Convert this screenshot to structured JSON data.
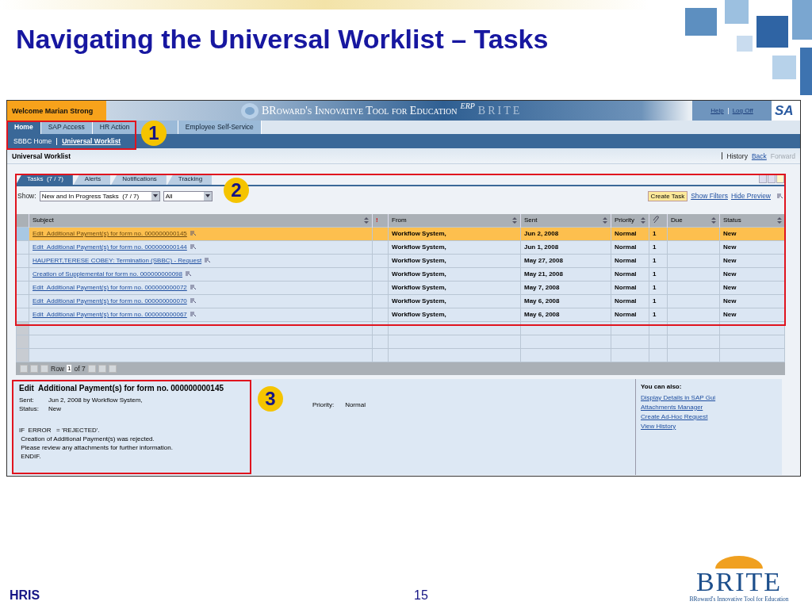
{
  "slide_title": "Navigating the Universal Worklist – Tasks",
  "screen": {
    "welcome": "Welcome Marian Strong",
    "banner": {
      "title": "BRoward's Innovative Tool for Education",
      "erp": "ERP",
      "brite": "BRITE"
    },
    "header_links": [
      "Help",
      "Log Off"
    ],
    "logo": "SA",
    "nav_tabs": [
      {
        "label": "Home",
        "selected": true
      },
      {
        "label": "SAP Access",
        "selected": false
      },
      {
        "label": "HR Action",
        "selected": false
      },
      {
        "label": "Employee Self-Service",
        "selected": false
      }
    ],
    "subnav": [
      {
        "label": "SBBC Home",
        "selected": false
      },
      {
        "label": "Universal Worklist",
        "selected": true
      }
    ],
    "page_title": "Universal Worklist",
    "history": {
      "history": "History",
      "back": "Back",
      "forward": "Forward",
      "forward_disabled": true
    },
    "worklist_tabs": [
      {
        "label": "Tasks  (7 / 7)",
        "selected": true
      },
      {
        "label": "Alerts",
        "selected": false
      },
      {
        "label": "Notifications",
        "selected": false
      },
      {
        "label": "Tracking",
        "selected": false
      }
    ],
    "show": {
      "label": "Show:",
      "filter": "New and In Progress Tasks  (7 / 7)",
      "scope": "All"
    },
    "actions": {
      "create": "Create Task",
      "show_filters": "Show Filters",
      "hide_preview": "Hide Preview"
    },
    "table": {
      "columns": [
        {
          "kind": "text",
          "label": "Subject",
          "sortable": true
        },
        {
          "kind": "text",
          "label": "!",
          "sortable": false
        },
        {
          "kind": "text",
          "label": "From",
          "sortable": true
        },
        {
          "kind": "text",
          "label": "Sent",
          "sortable": true
        },
        {
          "kind": "text",
          "label": "Priority",
          "sortable": true
        },
        {
          "kind": "icon"
        },
        {
          "kind": "text",
          "label": "Due",
          "sortable": true
        },
        {
          "kind": "text",
          "label": "Status",
          "sortable": true
        }
      ],
      "rows": [
        {
          "subject": "Edit  Additional Payment(s) for form no. 000000000145",
          "from": "Workflow System,",
          "sent": "Jun 2, 2008",
          "priority": "Normal",
          "attachments": "1",
          "status": "New",
          "selected": true
        },
        {
          "subject": "Edit  Additional Payment(s) for form no. 000000000144",
          "from": "Workflow System,",
          "sent": "Jun 1, 2008",
          "priority": "Normal",
          "attachments": "1",
          "status": "New",
          "selected": false
        },
        {
          "subject": "HAUPERT,TERESE COBEY: Termination (SBBC) - Request",
          "from": "Workflow System,",
          "sent": "May 27, 2008",
          "priority": "Normal",
          "attachments": "1",
          "status": "New",
          "selected": false
        },
        {
          "subject": "Creation of Supplemental for form no. 000000000098",
          "from": "Workflow System,",
          "sent": "May 21, 2008",
          "priority": "Normal",
          "attachments": "1",
          "status": "New",
          "selected": false
        },
        {
          "subject": "Edit  Additional Payment(s) for form no. 000000000072",
          "from": "Workflow System,",
          "sent": "May 7, 2008",
          "priority": "Normal",
          "attachments": "1",
          "status": "New",
          "selected": false
        },
        {
          "subject": "Edit  Additional Payment(s) for form no. 000000000070",
          "from": "Workflow System,",
          "sent": "May 6, 2008",
          "priority": "Normal",
          "attachments": "1",
          "status": "New",
          "selected": false
        },
        {
          "subject": "Edit  Additional Payment(s) for form no. 000000000067",
          "from": "Workflow System,",
          "sent": "May 6, 2008",
          "priority": "Normal",
          "attachments": "1",
          "status": "New",
          "selected": false
        }
      ]
    },
    "pager": {
      "label": "Row",
      "value": "1",
      "total": "of 7"
    },
    "preview": {
      "title": "Edit  Additional Payment(s) for form no. 000000000145",
      "fields": [
        {
          "label": "Sent:",
          "value": "Jun 2, 2008 by Workflow System,"
        },
        {
          "label": "Status:",
          "value": "New"
        }
      ],
      "priority": {
        "label": "Priority:",
        "value": "Normal"
      },
      "body": [
        "IF  ERROR   = 'REJECTED'.",
        " Creation of Additional Payment(s) was rejected.",
        " Please review any attachments for further information.",
        " ENDIF."
      ],
      "also": {
        "heading": "You can also:",
        "links": [
          "Display Details in SAP Gui",
          "Attachments Manager",
          "Create Ad-Hoc Request",
          "View History"
        ]
      }
    }
  },
  "callouts": [
    "1",
    "2",
    "3"
  ],
  "footer": {
    "left": "HRIS",
    "page": "15",
    "logo": {
      "name": "BRITE",
      "tagline": "BRoward's Innovative Tool for Education"
    }
  }
}
